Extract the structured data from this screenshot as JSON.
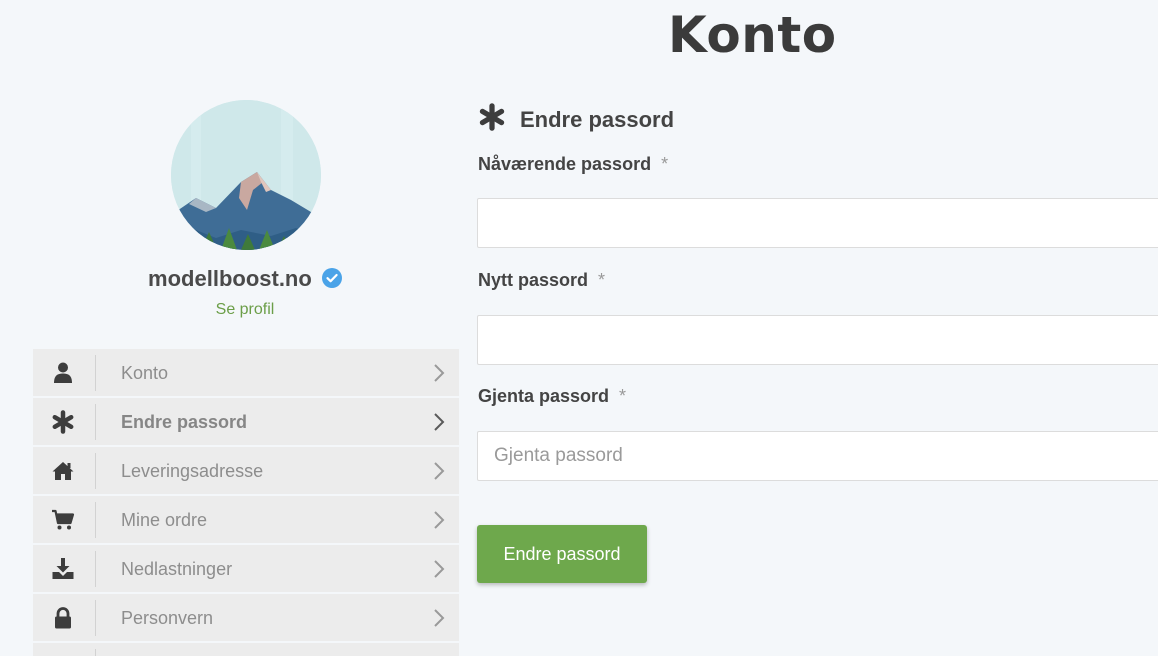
{
  "page": {
    "title": "Konto"
  },
  "profile": {
    "name": "modellboost.no",
    "link_label": "Se profil",
    "verified_icon": "verified-check-icon",
    "avatar": "mountain-avatar"
  },
  "sidebar": {
    "items": [
      {
        "label": "Konto",
        "icon": "user-icon",
        "active": false
      },
      {
        "label": "Endre passord",
        "icon": "asterisk-icon",
        "active": true
      },
      {
        "label": "Leveringsadresse",
        "icon": "home-icon",
        "active": false
      },
      {
        "label": "Mine ordre",
        "icon": "cart-icon",
        "active": false
      },
      {
        "label": "Nedlastninger",
        "icon": "download-icon",
        "active": false
      },
      {
        "label": "Personvern",
        "icon": "lock-icon",
        "active": false
      }
    ]
  },
  "form": {
    "heading": "Endre passord",
    "required_mark": "*",
    "fields": [
      {
        "label": "Nåværende passord",
        "value": "",
        "placeholder": ""
      },
      {
        "label": "Nytt passord",
        "value": "",
        "placeholder": ""
      },
      {
        "label": "Gjenta passord",
        "value": "",
        "placeholder": "Gjenta passord"
      }
    ],
    "submit_label": "Endre passord"
  },
  "colors": {
    "accent_green": "#6ea84c",
    "link_green": "#6b9e48",
    "verified_blue": "#4aa3e8",
    "background": "#f4f7fa"
  }
}
